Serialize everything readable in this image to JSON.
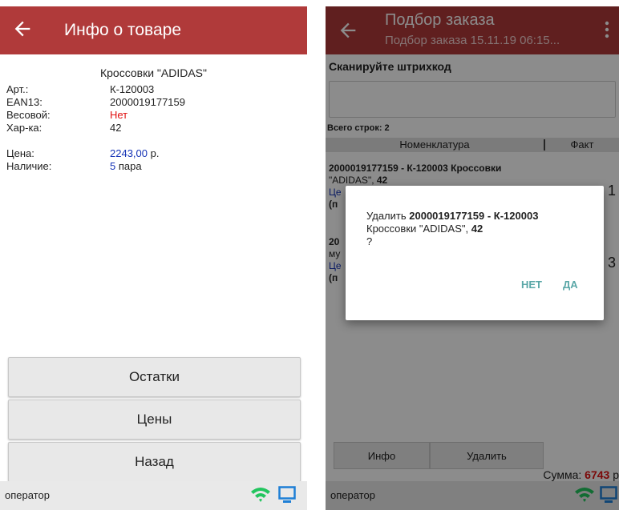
{
  "left": {
    "title": "Инфо о товаре",
    "product_name": "Кроссовки \"ADIDAS\"",
    "fields": [
      {
        "label": "Арт.:",
        "value": "К-120003"
      },
      {
        "label": "EAN13:",
        "value": "2000019177159"
      },
      {
        "label": "Весовой:",
        "value": "Нет"
      },
      {
        "label": "Хар-ка:",
        "value": "42"
      }
    ],
    "price": {
      "label": "Цена:",
      "amount": "2243,00",
      "unit": "р."
    },
    "stock": {
      "label": "Наличие:",
      "amount": "5",
      "unit": "пара"
    },
    "buttons": {
      "stock": "Остатки",
      "prices": "Цены",
      "back": "Назад"
    },
    "status": {
      "operator": "оператор"
    }
  },
  "right": {
    "title": "Подбор заказа",
    "subtitle": "Подбор заказа 15.11.19 06:15...",
    "scan_label": "Сканируйте штрихкод",
    "total_rows": "Всего строк: 2",
    "columns": [
      "Номенклатура",
      "Факт"
    ],
    "item1": {
      "line1": "2000019177159 - К-120003 Кроссовки",
      "line2_a": "\"ADIDAS\", ",
      "line2_b": "42",
      "line3": "Це",
      "line4": "(п",
      "qty": "1"
    },
    "item2": {
      "line1": "20",
      "line2": "му",
      "line3": "Це",
      "line4": "(п",
      "qty": "3"
    },
    "dialog": {
      "prefix": "Удалить ",
      "code": "2000019177159 - К-120003",
      "name": "Кроссовки \"ADIDAS\", ",
      "size": "42",
      "question": "?",
      "no": "НЕТ",
      "yes": "ДА"
    },
    "buttons": {
      "info": "Инфо",
      "delete": "Удалить"
    },
    "sum": {
      "label": "Сумма: ",
      "value": "6743",
      "unit": " р"
    },
    "status": {
      "operator": "оператор"
    }
  },
  "colors": {
    "appbar": "#b03a3a",
    "wifi": "#22c55e",
    "monitor": "#1e7fd6",
    "accent_red": "#e01010",
    "accent_blue": "#1533b6",
    "dialog_button": "#5aa7a7"
  }
}
